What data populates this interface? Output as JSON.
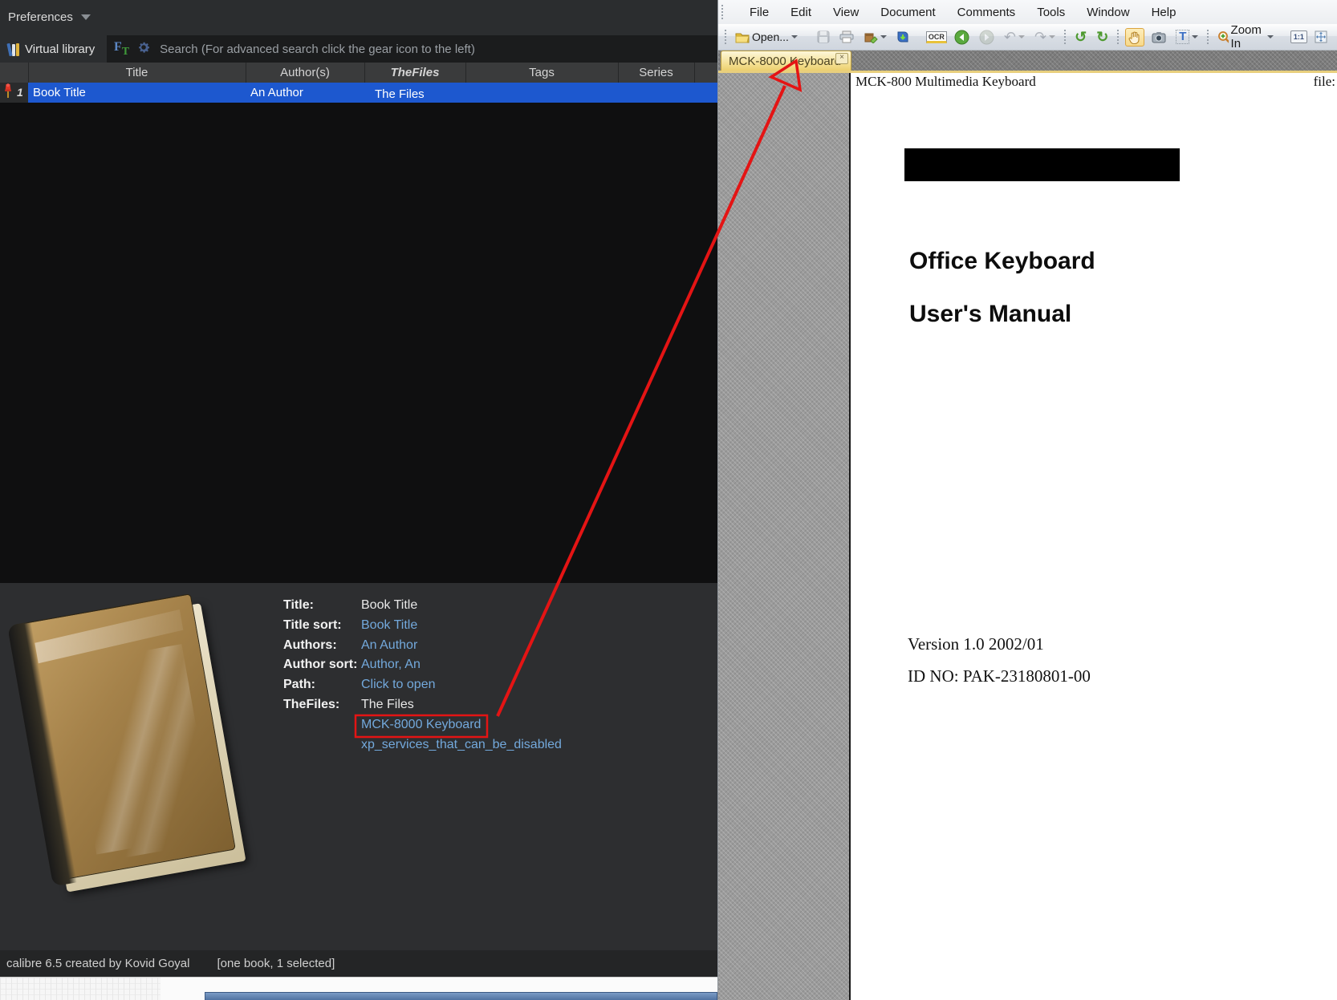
{
  "calibre": {
    "preferences_label": "Preferences",
    "virtual_library_label": "Virtual library",
    "search_placeholder": "Search (For advanced search click the gear icon to the left)",
    "table": {
      "columns": [
        "Title",
        "Author(s)",
        "TheFiles",
        "Tags",
        "Series"
      ],
      "rows": [
        {
          "index": "1",
          "title": "Book Title",
          "authors": "An Author",
          "thefiles": "The Files"
        }
      ]
    },
    "details": {
      "fields": [
        {
          "label": "Title:",
          "value": "Book Title"
        },
        {
          "label": "Title sort:",
          "value": "Book Title"
        },
        {
          "label": "Authors:",
          "value": "An Author"
        },
        {
          "label": "Author sort:",
          "value": "Author, An"
        },
        {
          "label": "Path:",
          "value": "Click to open"
        },
        {
          "label": "TheFiles:",
          "value": "The Files"
        }
      ],
      "extra_links": [
        "MCK-8000 Keyboard",
        "xp_services_that_can_be_disabled"
      ]
    },
    "status": {
      "left": "calibre 6.5 created by Kovid Goyal",
      "right": "[one book, 1 selected]"
    }
  },
  "pdf_viewer": {
    "menu": [
      "File",
      "Edit",
      "View",
      "Document",
      "Comments",
      "Tools",
      "Window",
      "Help"
    ],
    "toolbar": {
      "open_label": "Open...",
      "ocr_label": "OCR",
      "zoom_in_label": "Zoom In",
      "actual_size_label": "1:1"
    },
    "tab": {
      "title": "MCK-8000 Keyboard"
    },
    "page": {
      "header_left": "MCK-800 Multimedia Keyboard",
      "header_right": "file:",
      "heading1": "Office Keyboard",
      "heading2": "User's Manual",
      "version": "Version 1.0 2002/01",
      "id_no": "ID NO: PAK-23180801-00"
    }
  },
  "icons": {
    "dropdown_glyph": "▾",
    "close_glyph": "×",
    "undo_glyph": "↶",
    "redo_glyph": "↷",
    "rotate_left_glyph": "↺",
    "rotate_right_glyph": "↻",
    "ft_f": "F",
    "ft_t": "T",
    "text_select_glyph": "T"
  },
  "colors": {
    "selection_blue": "#1d58cf",
    "link_blue": "#73a9dc",
    "annotation_red": "#e41414",
    "tab_yellow": "#f3dd8d"
  }
}
